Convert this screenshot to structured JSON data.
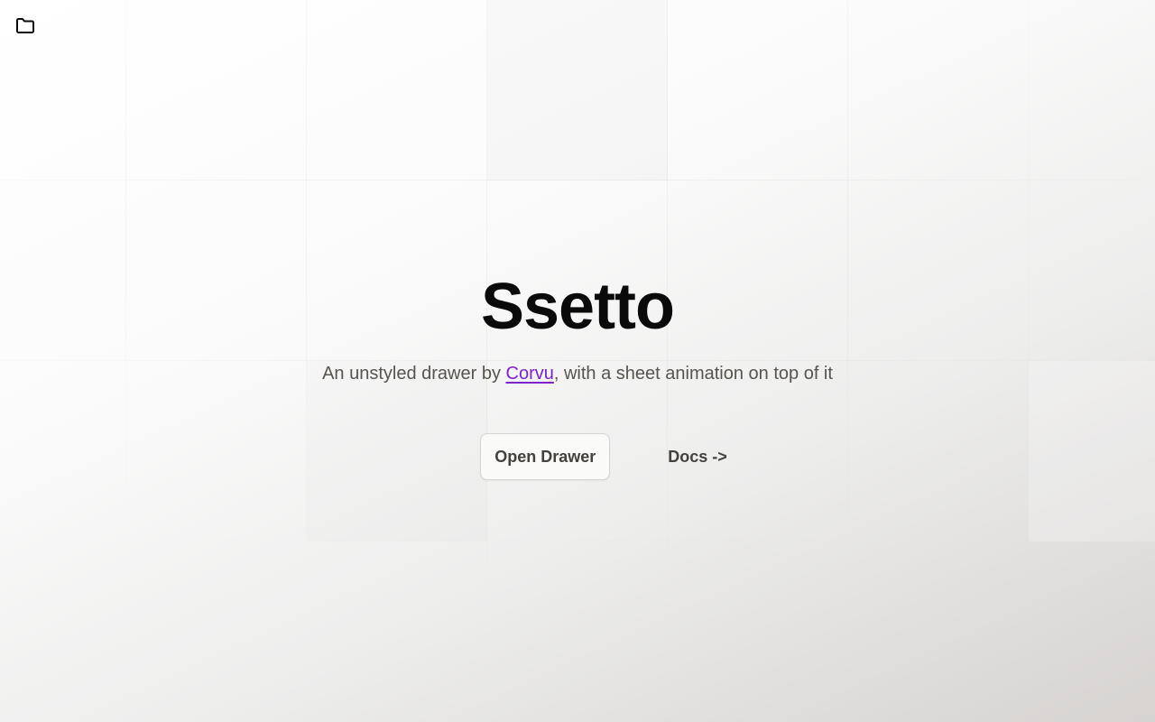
{
  "header": {
    "folder_icon": "folder-icon"
  },
  "hero": {
    "title": "Ssetto",
    "subtitle_prefix": "An unstyled drawer by ",
    "subtitle_link": "Corvu",
    "subtitle_suffix": ", with a sheet animation on top of it"
  },
  "actions": {
    "open_drawer_label": "Open Drawer",
    "docs_label": "Docs ->"
  },
  "colors": {
    "title": "#0a0a0a",
    "subtitle": "#57534e",
    "link": "#7e22ce",
    "button_text": "#44403c",
    "button_bg": "#fafaf9",
    "button_border": "#d6d3d1"
  }
}
